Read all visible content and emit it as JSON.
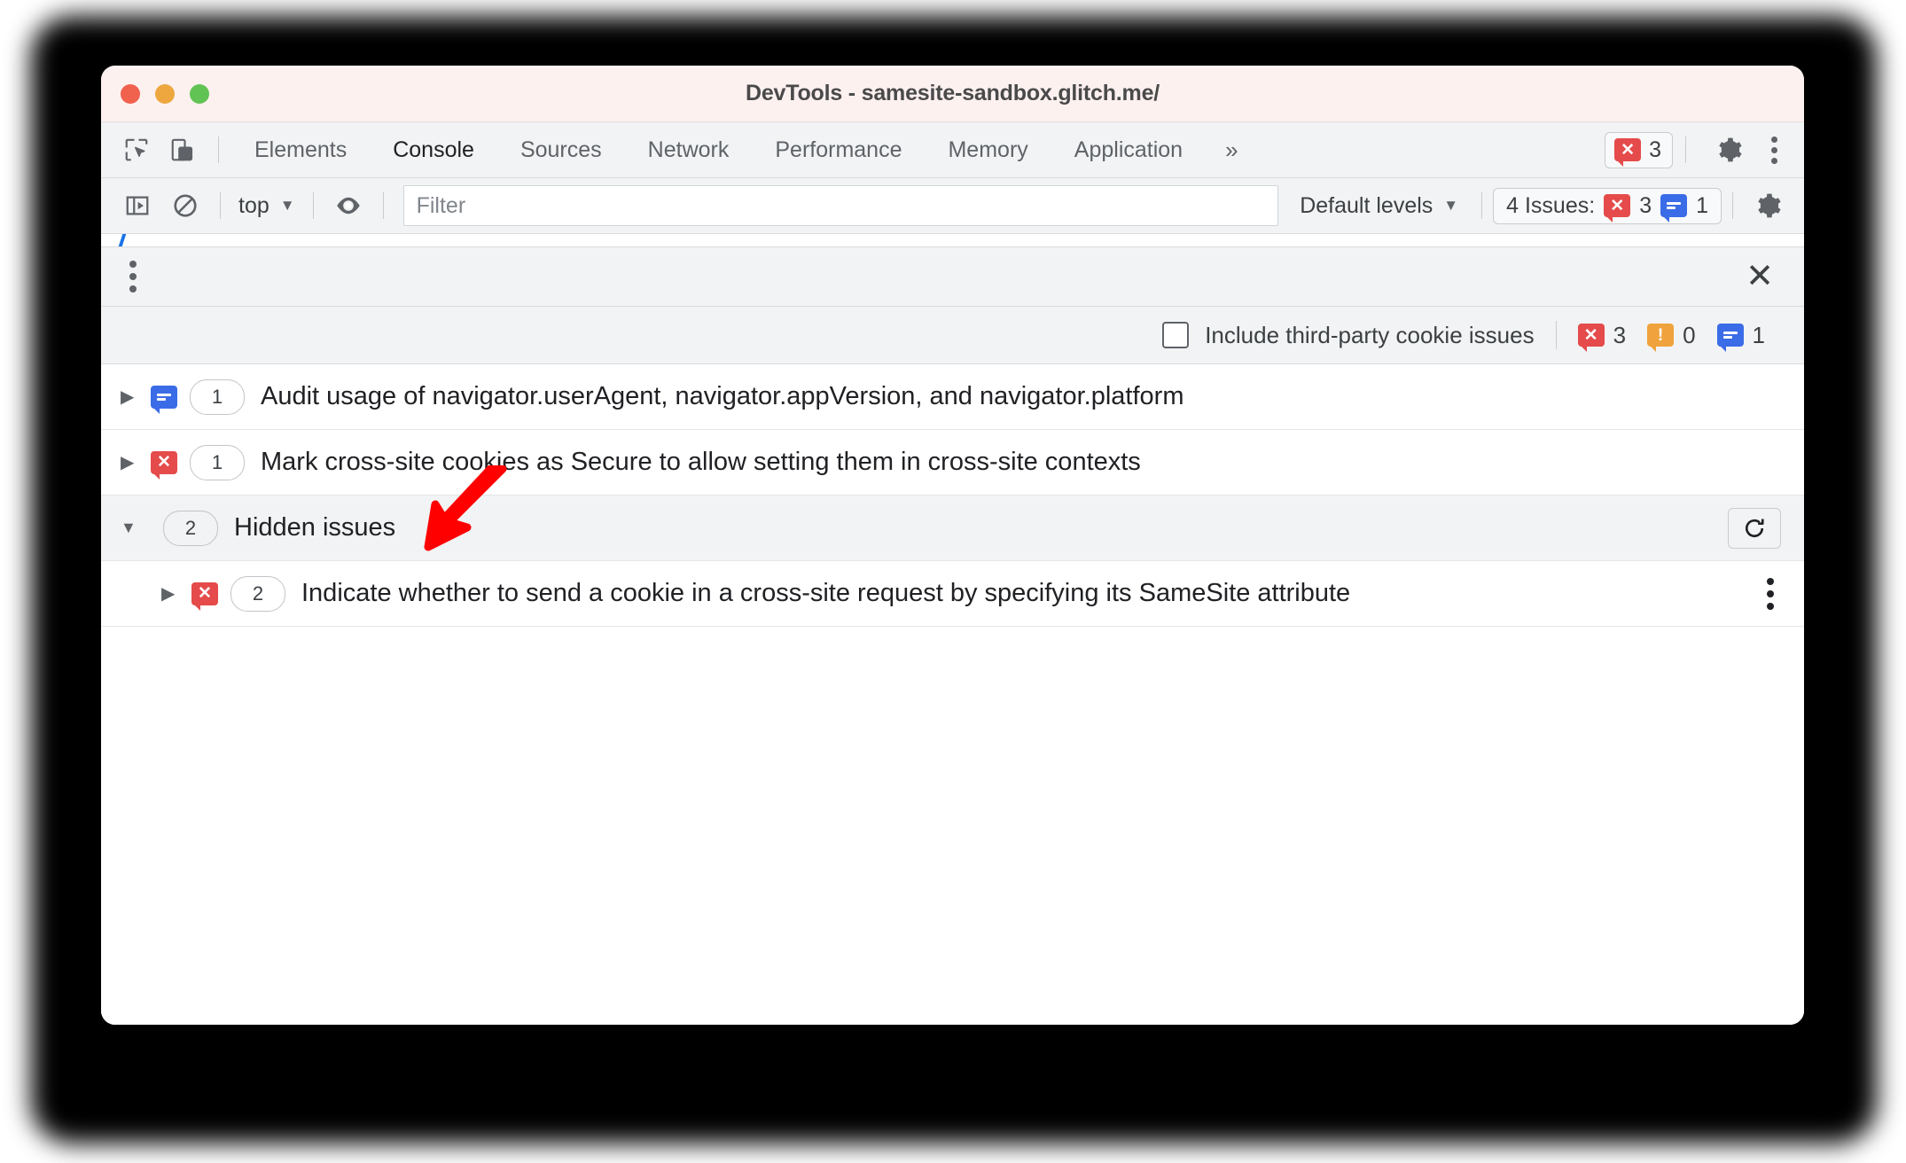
{
  "window": {
    "title": "DevTools - samesite-sandbox.glitch.me/",
    "traffic_lights": [
      "close-red",
      "minimize-yellow",
      "zoom-green"
    ]
  },
  "main_tabbar": {
    "icons": [
      "inspect-element-icon",
      "device-toolbar-icon"
    ],
    "tabs": [
      {
        "label": "Elements",
        "active": false
      },
      {
        "label": "Console",
        "active": true
      },
      {
        "label": "Sources",
        "active": false
      },
      {
        "label": "Network",
        "active": false
      },
      {
        "label": "Performance",
        "active": false
      },
      {
        "label": "Memory",
        "active": false
      },
      {
        "label": "Application",
        "active": false
      }
    ],
    "more_tabs": "»",
    "error_badge": {
      "icon": "error-bubble-icon",
      "count": "3"
    },
    "settings_icon": "gear-icon",
    "more_icon": "kebab-menu-icon"
  },
  "console_toolbar": {
    "sidebar_toggle_icon": "console-sidebar-icon",
    "clear_icon": "clear-console-icon",
    "context": "top",
    "context_caret": "▼",
    "eye_icon": "live-expression-icon",
    "filter": {
      "value": "",
      "placeholder": "Filter"
    },
    "levels": {
      "label": "Default levels",
      "caret": "▼"
    },
    "issues_button": {
      "label": "4 Issues:",
      "errors": "3",
      "info": "1"
    },
    "settings_icon": "gear-icon"
  },
  "drawer": {
    "kebab_icon": "drawer-menu-icon",
    "close_icon": "close-icon",
    "subbar": {
      "checkbox_label": "Include third-party cookie issues",
      "checkbox_checked": false,
      "errors": "3",
      "warnings": "0",
      "info": "1"
    },
    "issues": [
      {
        "severity": "info",
        "icon": "info-bubble-icon",
        "count": "1",
        "expander": "▶",
        "text": "Audit usage of navigator.userAgent, navigator.appVersion, and navigator.platform"
      },
      {
        "severity": "error",
        "icon": "error-bubble-icon",
        "count": "1",
        "expander": "▶",
        "text": "Mark cross-site cookies as Secure to allow setting them in cross-site contexts"
      }
    ],
    "hidden_group": {
      "expander": "▼",
      "count": "2",
      "title": "Hidden issues",
      "refresh_icon": "refresh-icon",
      "children": [
        {
          "severity": "error",
          "icon": "error-bubble-icon",
          "count": "2",
          "expander": "▶",
          "text": "Indicate whether to send a cookie in a cross-site request by specifying its SameSite attribute",
          "kebab_icon": "row-menu-icon"
        }
      ]
    }
  },
  "annotation": {
    "arrow_color": "#ff0000",
    "arrow_name": "red-pointer-arrow"
  },
  "colors": {
    "error_red": "#e54b4b",
    "info_blue": "#3b6ce7",
    "warning_orange": "#f0a33c",
    "accent_blue": "#1a73e8",
    "toolbar_bg": "#f1f3f4",
    "titlebar_bg": "#fdf1f0"
  }
}
